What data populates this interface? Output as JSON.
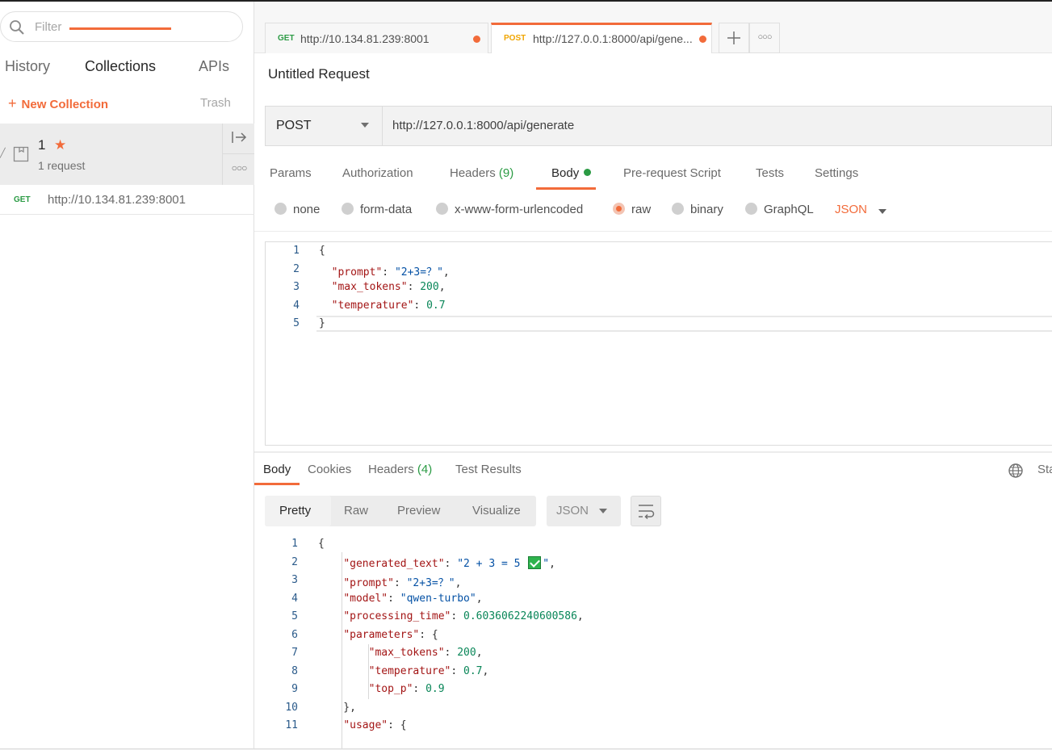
{
  "sidebar": {
    "filter_placeholder": "Filter",
    "tabs": [
      "History",
      "Collections",
      "APIs"
    ],
    "active_tab": "Collections",
    "new_collection": "New Collection",
    "trash": "Trash",
    "collection": {
      "name": "1",
      "subtitle": "1 request"
    },
    "requests": [
      {
        "method": "GET",
        "url": "http://10.134.81.239:8001"
      }
    ]
  },
  "tabs": [
    {
      "method": "GET",
      "url": "http://10.134.81.239:8001",
      "method_color": "#2b9b44"
    },
    {
      "method": "POST",
      "url": "http://127.0.0.1:8000/api/gene...",
      "method_color": "#f0a500"
    }
  ],
  "request": {
    "title": "Untitled Request",
    "method": "POST",
    "url": "http://127.0.0.1:8000/api/generate",
    "tabs": {
      "params": "Params",
      "authorization": "Authorization",
      "headers": "Headers",
      "headers_count": "(9)",
      "body": "Body",
      "prerequest": "Pre-request Script",
      "tests": "Tests",
      "settings": "Settings"
    },
    "body_types": [
      "none",
      "form-data",
      "x-www-form-urlencoded",
      "raw",
      "binary",
      "GraphQL"
    ],
    "selected_body_type": "raw",
    "raw_format": "JSON",
    "body_lines": [
      {
        "n": "1",
        "tokens": [
          [
            "p",
            "{"
          ]
        ]
      },
      {
        "n": "2",
        "tokens": [
          [
            "p",
            "  "
          ],
          [
            "k",
            "\"prompt\""
          ],
          [
            "p",
            ": "
          ],
          [
            "s",
            "\"2+3=？\""
          ],
          [
            "p",
            ","
          ]
        ]
      },
      {
        "n": "3",
        "tokens": [
          [
            "p",
            "  "
          ],
          [
            "k",
            "\"max_tokens\""
          ],
          [
            "p",
            ": "
          ],
          [
            "n",
            "200"
          ],
          [
            "p",
            ","
          ]
        ]
      },
      {
        "n": "4",
        "tokens": [
          [
            "p",
            "  "
          ],
          [
            "k",
            "\"temperature\""
          ],
          [
            "p",
            ": "
          ],
          [
            "n",
            "0.7"
          ]
        ]
      },
      {
        "n": "5",
        "tokens": [
          [
            "p",
            "}"
          ]
        ]
      }
    ]
  },
  "response": {
    "tabs": {
      "body": "Body",
      "cookies": "Cookies",
      "headers": "Headers",
      "headers_count": "(4)",
      "test_results": "Test Results"
    },
    "status_label": "Sta",
    "view_modes": [
      "Pretty",
      "Raw",
      "Preview",
      "Visualize"
    ],
    "active_view": "Pretty",
    "format": "JSON",
    "lines": [
      {
        "n": "1",
        "tokens": [
          [
            "p",
            "{"
          ]
        ]
      },
      {
        "n": "2",
        "tokens": [
          [
            "p",
            "    "
          ],
          [
            "k",
            "\"generated_text\""
          ],
          [
            "p",
            ": "
          ],
          [
            "s",
            "\"2 + 3 = 5 "
          ],
          [
            "check",
            ""
          ],
          [
            "s",
            "\""
          ],
          [
            "p",
            ","
          ]
        ]
      },
      {
        "n": "3",
        "tokens": [
          [
            "p",
            "    "
          ],
          [
            "k",
            "\"prompt\""
          ],
          [
            "p",
            ": "
          ],
          [
            "s",
            "\"2+3=？\""
          ],
          [
            "p",
            ","
          ]
        ]
      },
      {
        "n": "4",
        "tokens": [
          [
            "p",
            "    "
          ],
          [
            "k",
            "\"model\""
          ],
          [
            "p",
            ": "
          ],
          [
            "s",
            "\"qwen-turbo\""
          ],
          [
            "p",
            ","
          ]
        ]
      },
      {
        "n": "5",
        "tokens": [
          [
            "p",
            "    "
          ],
          [
            "k",
            "\"processing_time\""
          ],
          [
            "p",
            ": "
          ],
          [
            "n",
            "0.6036062240600586"
          ],
          [
            "p",
            ","
          ]
        ]
      },
      {
        "n": "6",
        "tokens": [
          [
            "p",
            "    "
          ],
          [
            "k",
            "\"parameters\""
          ],
          [
            "p",
            ": {"
          ]
        ]
      },
      {
        "n": "7",
        "tokens": [
          [
            "p",
            "        "
          ],
          [
            "k",
            "\"max_tokens\""
          ],
          [
            "p",
            ": "
          ],
          [
            "n",
            "200"
          ],
          [
            "p",
            ","
          ]
        ]
      },
      {
        "n": "8",
        "tokens": [
          [
            "p",
            "        "
          ],
          [
            "k",
            "\"temperature\""
          ],
          [
            "p",
            ": "
          ],
          [
            "n",
            "0.7"
          ],
          [
            "p",
            ","
          ]
        ]
      },
      {
        "n": "9",
        "tokens": [
          [
            "p",
            "        "
          ],
          [
            "k",
            "\"top_p\""
          ],
          [
            "p",
            ": "
          ],
          [
            "n",
            "0.9"
          ]
        ]
      },
      {
        "n": "10",
        "tokens": [
          [
            "p",
            "    },"
          ]
        ]
      },
      {
        "n": "11",
        "tokens": [
          [
            "p",
            "    "
          ],
          [
            "k",
            "\"usage\""
          ],
          [
            "p",
            ": {"
          ]
        ]
      }
    ]
  },
  "colors": {
    "accent": "#f26b3a",
    "get": "#2b9b44",
    "post": "#f0a500",
    "key": "#a31515",
    "string": "#0451a5",
    "number": "#098658"
  }
}
